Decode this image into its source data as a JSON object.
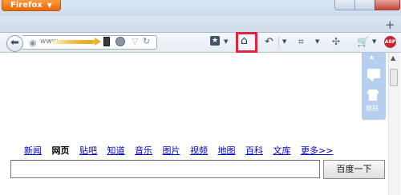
{
  "app": {
    "menu_button": "Firefox",
    "new_tab": "+"
  },
  "urlbar": {
    "url_prefix": "www"
  },
  "toolbar": {
    "icons": [
      "back-icon",
      "globe-icon",
      "phone-icon",
      "clock-icon",
      "star-icon",
      "reload-icon",
      "bookmarks-menu-icon",
      "home-icon",
      "undo-icon",
      "crop-icon",
      "share-icon",
      "cart-icon",
      "adblock-icon"
    ],
    "adblock_label": "ABP",
    "highlight_color": "#e4233f"
  },
  "side_panel": {
    "skin_label": "换肤"
  },
  "baidu": {
    "nav": [
      "新闻",
      "网页",
      "贴吧",
      "知道",
      "音乐",
      "图片",
      "视频",
      "地图",
      "百科",
      "文库",
      "更多>>"
    ],
    "active_index": 1,
    "search_value": "",
    "search_button": "百度一下"
  }
}
